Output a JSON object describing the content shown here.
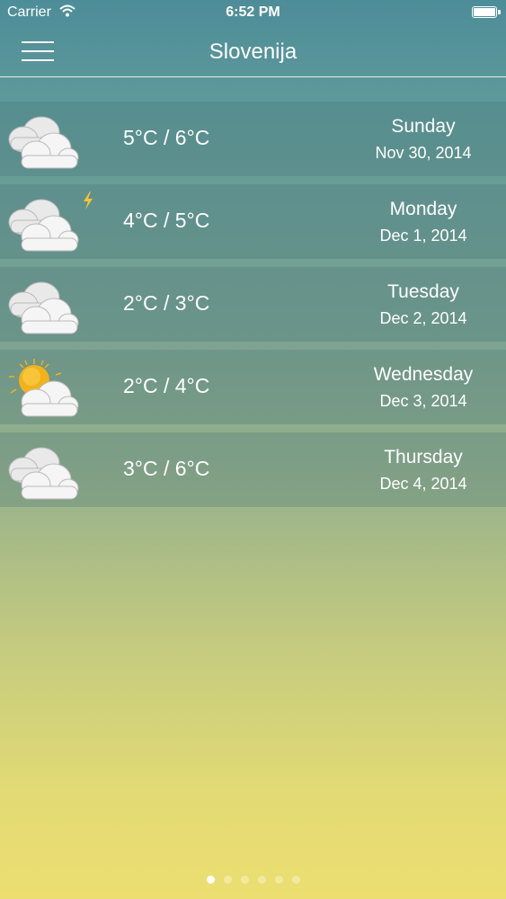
{
  "status_bar": {
    "carrier": "Carrier",
    "time": "6:52 PM"
  },
  "nav": {
    "title": "Slovenija"
  },
  "forecast": [
    {
      "icon": "cloudy-icon",
      "temp": "5°C / 6°C",
      "day": "Sunday",
      "date": "Nov 30, 2014"
    },
    {
      "icon": "thunder-cloud-icon",
      "temp": "4°C / 5°C",
      "day": "Monday",
      "date": "Dec 1, 2014"
    },
    {
      "icon": "cloudy-icon",
      "temp": "2°C / 3°C",
      "day": "Tuesday",
      "date": "Dec 2, 2014"
    },
    {
      "icon": "partly-sunny-icon",
      "temp": "2°C / 4°C",
      "day": "Wednesday",
      "date": "Dec 3, 2014"
    },
    {
      "icon": "cloudy-icon",
      "temp": "3°C / 6°C",
      "day": "Thursday",
      "date": "Dec 4, 2014"
    }
  ],
  "page_indicator": {
    "count": 6,
    "active_index": 0
  },
  "colors": {
    "sun": "#f3b21a",
    "cloud": "#f2f2f2",
    "bolt": "#f4c430"
  }
}
